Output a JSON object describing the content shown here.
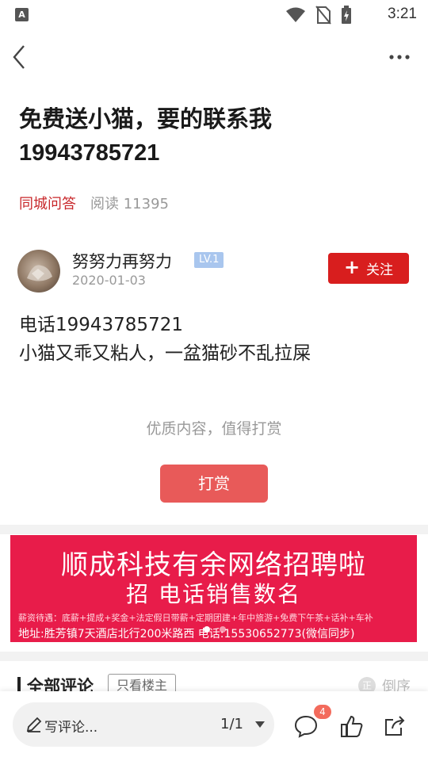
{
  "status_bar": {
    "app_icon_letter": "A",
    "time": "3:21",
    "icons": [
      "wifi-icon",
      "no-sim-icon",
      "battery-charging-icon"
    ]
  },
  "nav": {
    "back_icon": "chevron-left-icon",
    "more_icon": "more-horizontal-icon"
  },
  "post": {
    "title": "免费送小猫，要的联系我19943785721",
    "category": "同城问答",
    "reads": "阅读 11395",
    "body_lines": [
      "电话19943785721",
      "小猫又乖又粘人，一盆猫砂不乱拉屎"
    ]
  },
  "author": {
    "name": "努努力再努力",
    "level": "LV.1",
    "date": "2020-01-03",
    "follow_label": "关注",
    "follow_icon": "+"
  },
  "reward": {
    "hint": "优质内容，值得打赏",
    "button_label": "打赏"
  },
  "ad": {
    "title": "顺成科技有余网络招聘啦",
    "subtitle": "招 电话销售数名",
    "benefits": "薪资待遇：底薪+提成+奖金+法定假日带薪+定期团建+年中旅游+免费下午茶+话补+车补",
    "address": "地址:胜芳镇7天酒店北行200米路西   电话:15530652773(微信同步)",
    "slide_count": 2,
    "active_slide": 1,
    "background_color": "#e81c4a"
  },
  "comments": {
    "header": "全部评论",
    "owner_only_label": "只看楼主",
    "sort_label": "倒序",
    "sort_icon": "正"
  },
  "bottom_bar": {
    "write_placeholder": "写评论...",
    "page_indicator": "1/1",
    "comment_count": "4",
    "icons": [
      "comment-icon",
      "like-icon",
      "share-icon"
    ]
  },
  "colors": {
    "accent_red": "#d81e1e",
    "category_red": "#c8272a",
    "reward_button": "#e85a59",
    "level_badge": "#a9c6ee"
  }
}
